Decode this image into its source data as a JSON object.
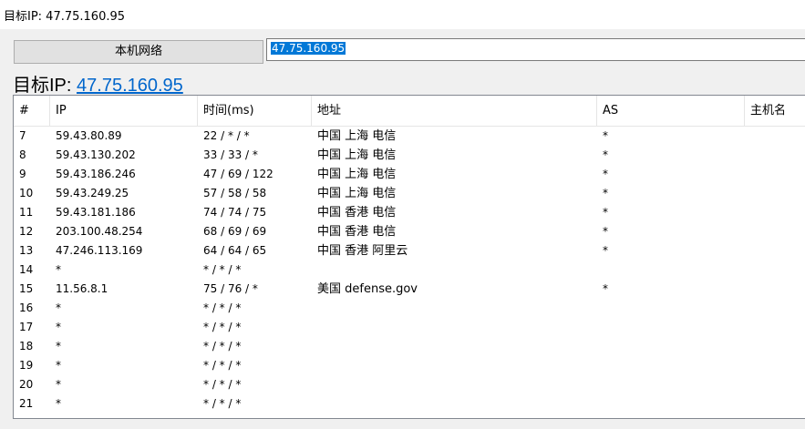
{
  "window": {
    "title": "目标IP: 47.75.160.95"
  },
  "toolbar": {
    "local_network_button": "本机网络",
    "ip_input_value": "47.75.160.95"
  },
  "target": {
    "label": "目标IP: ",
    "ip": "47.75.160.95"
  },
  "table": {
    "columns": [
      "#",
      "IP",
      "时间(ms)",
      "地址",
      "AS",
      "主机名"
    ],
    "rows": [
      {
        "num": "7",
        "ip": "59.43.80.89",
        "time": "22 / * / *",
        "addr": "中国 上海 电信",
        "as": "*",
        "host": ""
      },
      {
        "num": "8",
        "ip": "59.43.130.202",
        "time": "33 / 33 / *",
        "addr": "中国 上海 电信",
        "as": "*",
        "host": ""
      },
      {
        "num": "9",
        "ip": "59.43.186.246",
        "time": "47 / 69 / 122",
        "addr": "中国 上海 电信",
        "as": "*",
        "host": ""
      },
      {
        "num": "10",
        "ip": "59.43.249.25",
        "time": "57 / 58 / 58",
        "addr": "中国 上海 电信",
        "as": "*",
        "host": ""
      },
      {
        "num": "11",
        "ip": "59.43.181.186",
        "time": "74 / 74 / 75",
        "addr": "中国 香港 电信",
        "as": "*",
        "host": ""
      },
      {
        "num": "12",
        "ip": "203.100.48.254",
        "time": "68 / 69 / 69",
        "addr": "中国 香港 电信",
        "as": "*",
        "host": ""
      },
      {
        "num": "13",
        "ip": "47.246.113.169",
        "time": "64 / 64 / 65",
        "addr": "中国 香港 阿里云",
        "as": "*",
        "host": ""
      },
      {
        "num": "14",
        "ip": "*",
        "time": "* / * / *",
        "addr": "",
        "as": "",
        "host": ""
      },
      {
        "num": "15",
        "ip": "11.56.8.1",
        "time": "75 / 76 / *",
        "addr": "美国 defense.gov",
        "as": "*",
        "host": ""
      },
      {
        "num": "16",
        "ip": "*",
        "time": "* / * / *",
        "addr": "",
        "as": "",
        "host": ""
      },
      {
        "num": "17",
        "ip": "*",
        "time": "* / * / *",
        "addr": "",
        "as": "",
        "host": ""
      },
      {
        "num": "18",
        "ip": "*",
        "time": "* / * / *",
        "addr": "",
        "as": "",
        "host": ""
      },
      {
        "num": "19",
        "ip": "*",
        "time": "* / * / *",
        "addr": "",
        "as": "",
        "host": ""
      },
      {
        "num": "20",
        "ip": "*",
        "time": "* / * / *",
        "addr": "",
        "as": "",
        "host": ""
      },
      {
        "num": "21",
        "ip": "*",
        "time": "* / * / *",
        "addr": "",
        "as": "",
        "host": ""
      }
    ]
  }
}
